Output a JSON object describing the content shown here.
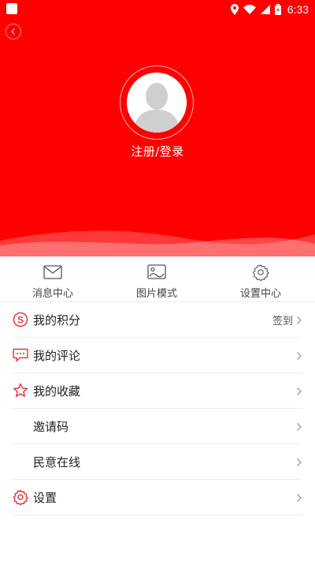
{
  "statusbar": {
    "time": "6:33",
    "icons": [
      "location-icon",
      "wifi-icon",
      "signal-icon",
      "battery-icon"
    ]
  },
  "header": {
    "login_text": "注册/登录",
    "background_color": "#ff0000"
  },
  "quick_actions": [
    {
      "label": "消息中心",
      "icon": "envelope-icon"
    },
    {
      "label": "图片模式",
      "icon": "image-icon"
    },
    {
      "label": "设置中心",
      "icon": "gear-icon"
    }
  ],
  "menu": [
    {
      "label": "我的积分",
      "icon": "points-icon",
      "extra": "签到"
    },
    {
      "label": "我的评论",
      "icon": "comment-icon",
      "extra": ""
    },
    {
      "label": "我的收藏",
      "icon": "star-icon",
      "extra": ""
    },
    {
      "label": "邀请码",
      "icon": "",
      "extra": ""
    },
    {
      "label": "民意在线",
      "icon": "",
      "extra": ""
    },
    {
      "label": "设置",
      "icon": "settings-gear-icon",
      "extra": ""
    }
  ],
  "colors": {
    "accent": "#ff0000",
    "icon_red": "#e63b3b",
    "text": "#222222",
    "divider": "#eeeeee"
  }
}
